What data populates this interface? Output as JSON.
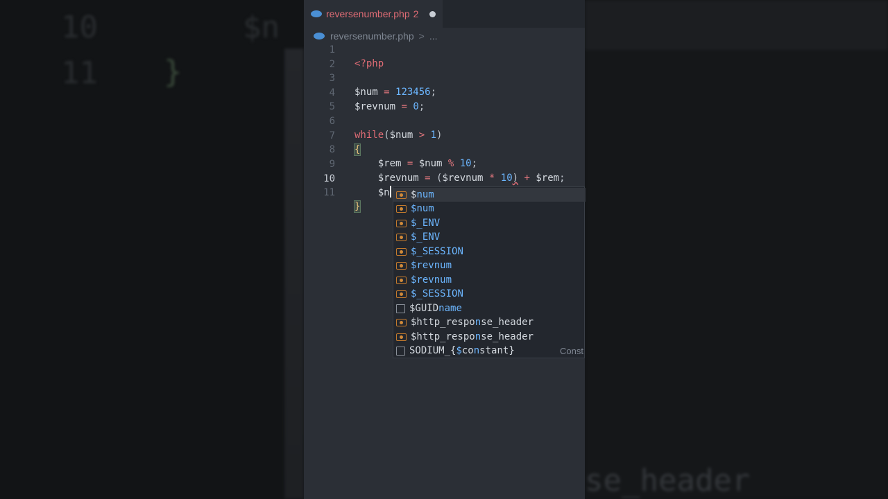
{
  "background": {
    "big_numbers": [
      "10",
      "11"
    ],
    "big_var": "$n",
    "big_brace": "}",
    "bottom_text": "se_header"
  },
  "tab": {
    "filename": "reversenumber.php",
    "problem_count": "2"
  },
  "breadcrumbs": {
    "file": "reversenumber.php",
    "separator": ">",
    "more": "..."
  },
  "editor": {
    "active_line": 10,
    "lines": [
      {
        "n": "1"
      },
      {
        "n": "2"
      },
      {
        "n": "3"
      },
      {
        "n": "4"
      },
      {
        "n": "5"
      },
      {
        "n": "6"
      },
      {
        "n": "7"
      },
      {
        "n": "8"
      },
      {
        "n": "9"
      },
      {
        "n": "10"
      },
      {
        "n": "11"
      }
    ],
    "code": {
      "l1": {
        "t1": "<?php"
      },
      "l3": {
        "t1": "$num",
        "t2": " = ",
        "t3": "123456",
        "t4": ";"
      },
      "l4": {
        "t1": "$revnum",
        "t2": " = ",
        "t3": "0",
        "t4": ";"
      },
      "l6": {
        "t1": "while",
        "t2": "(",
        "t3": "$num",
        "t4": " > ",
        "t5": "1",
        "t6": ")"
      },
      "l7": {
        "t1": "{"
      },
      "l8": {
        "t1": "    $rem",
        "t2": " = ",
        "t3": "$num",
        "t4": " % ",
        "t5": "10",
        "t6": ";"
      },
      "l9": {
        "t1": "    $revnum",
        "t2": " = ",
        "t3": "(",
        "t4": "$revnum",
        "t5": " * ",
        "t6": "10",
        "t7": ")",
        "t8": " + ",
        "t9": "$rem",
        "t10": ";"
      },
      "l10": {
        "t1": "    $n"
      },
      "l11": {
        "t1": "}"
      }
    }
  },
  "suggestions": {
    "selected_index": 0,
    "items": [
      {
        "pre": "$",
        "hl": "n",
        "post": "um",
        "kind": "variable-icon"
      },
      {
        "pre": "$",
        "hl": "n",
        "post": "um",
        "kind": "variable-icon"
      },
      {
        "pre": "$_E",
        "hl": "N",
        "post": "V",
        "kind": "variable-icon"
      },
      {
        "pre": "$_E",
        "hl": "N",
        "post": "V",
        "kind": "variable-icon"
      },
      {
        "pre": "$_SESSIO",
        "hl": "N",
        "post": "",
        "kind": "variable-icon"
      },
      {
        "pre": "$rev",
        "hl": "n",
        "post": "um",
        "kind": "variable-icon"
      },
      {
        "pre": "$rev",
        "hl": "n",
        "post": "um",
        "kind": "variable-icon"
      },
      {
        "pre": "$_SESSIO",
        "hl": "N",
        "post": "",
        "kind": "variable-icon"
      },
      {
        "pre": "$GUID",
        "hl": "n",
        "post": "ame",
        "kind": "constant-icon"
      },
      {
        "pre": "$http_respo",
        "hl": "n",
        "post": "se_header",
        "kind": "variable-icon"
      },
      {
        "pre": "$http_respo",
        "hl": "n",
        "post": "se_header",
        "kind": "variable-icon"
      },
      {
        "pre": "SODIUM_{",
        "hl": "$",
        "post": "co",
        "post2": "n",
        "post3": "stant}",
        "kind": "constant-icon",
        "detail": "Const"
      }
    ]
  }
}
